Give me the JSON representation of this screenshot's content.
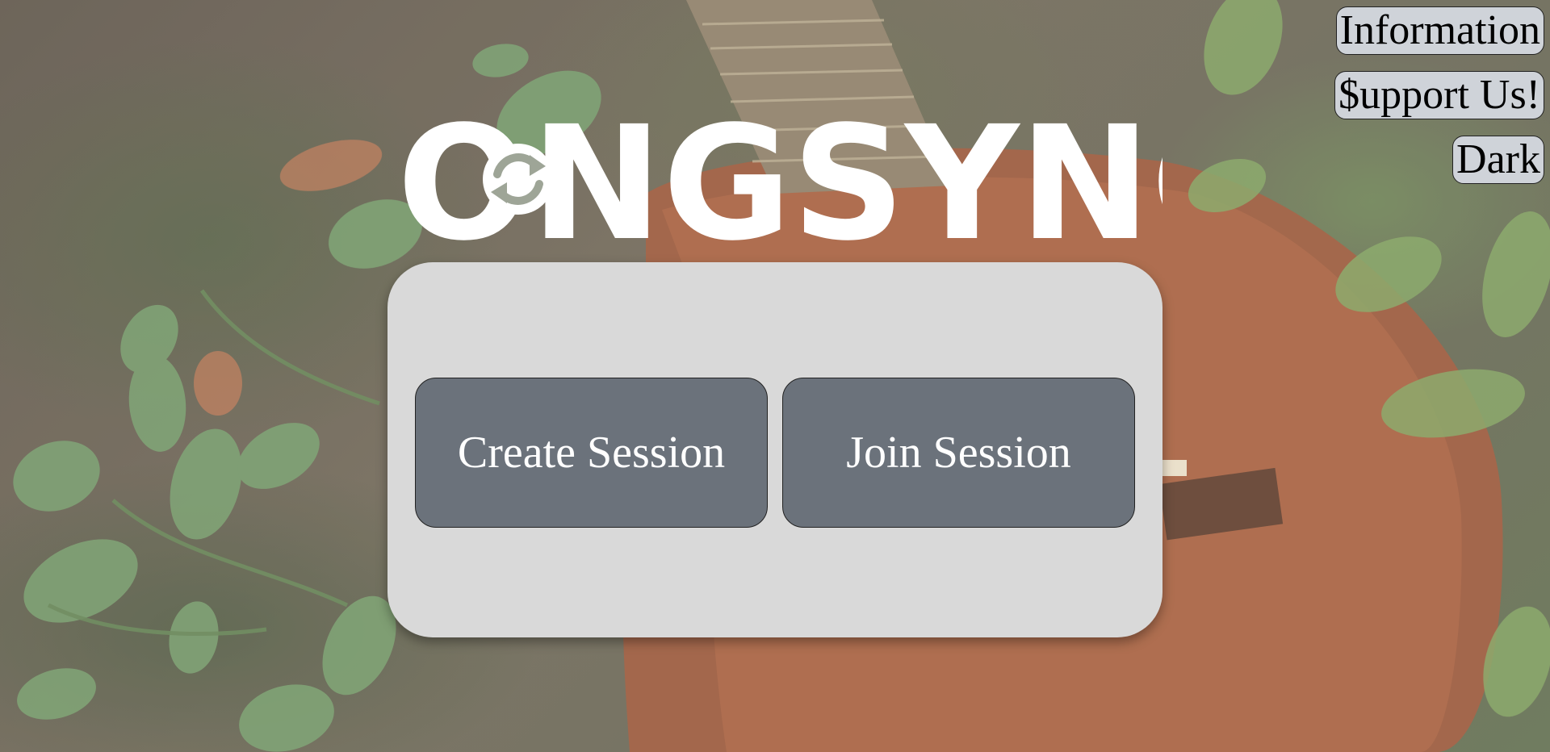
{
  "app": {
    "logo_text": "SONGSYNC",
    "logo_icon": "sync-icon"
  },
  "nav": {
    "information_label": "Information",
    "support_label": "$upport Us!",
    "theme_label": "Dark"
  },
  "main": {
    "create_label": "Create Session",
    "join_label": "Join Session"
  },
  "colors": {
    "card": "#d9d9d9",
    "session_button": "#6b727b",
    "top_button": "#cfd3d9",
    "logo": "#ffffff"
  }
}
